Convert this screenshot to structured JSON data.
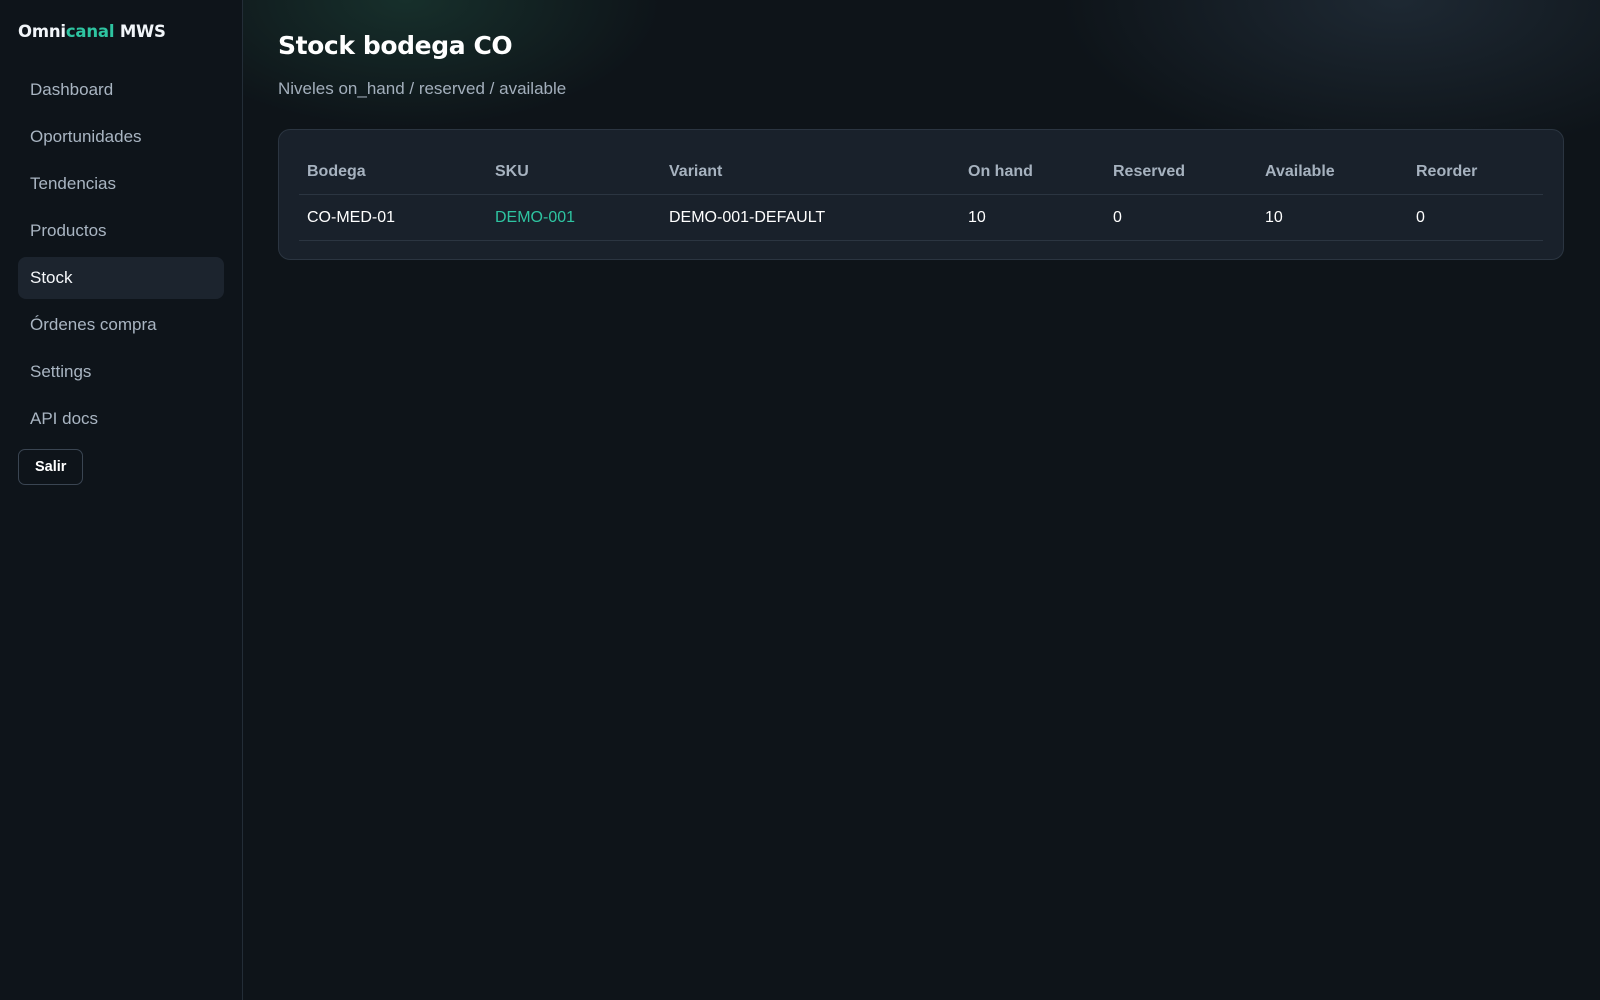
{
  "brand": {
    "part1": "Omni",
    "part2": "canal",
    "part3": " MWS"
  },
  "sidebar": {
    "items": [
      {
        "label": "Dashboard",
        "active": false
      },
      {
        "label": "Oportunidades",
        "active": false
      },
      {
        "label": "Tendencias",
        "active": false
      },
      {
        "label": "Productos",
        "active": false
      },
      {
        "label": "Stock",
        "active": true
      },
      {
        "label": "Órdenes compra",
        "active": false
      },
      {
        "label": "Settings",
        "active": false
      },
      {
        "label": "API docs",
        "active": false
      }
    ],
    "logout_label": "Salir"
  },
  "page": {
    "title": "Stock bodega CO",
    "subtitle": "Niveles on_hand / reserved / available"
  },
  "table": {
    "columns": [
      "Bodega",
      "SKU",
      "Variant",
      "On hand",
      "Reserved",
      "Available",
      "Reorder"
    ],
    "rows": [
      {
        "bodega": "CO-MED-01",
        "sku": "DEMO-001",
        "variant": "DEMO-001-DEFAULT",
        "on_hand": "10",
        "reserved": "0",
        "available": "10",
        "reorder": "0"
      }
    ]
  },
  "colors": {
    "accent": "#2ec4a1",
    "background": "#0e1419",
    "card": "#19212b"
  }
}
